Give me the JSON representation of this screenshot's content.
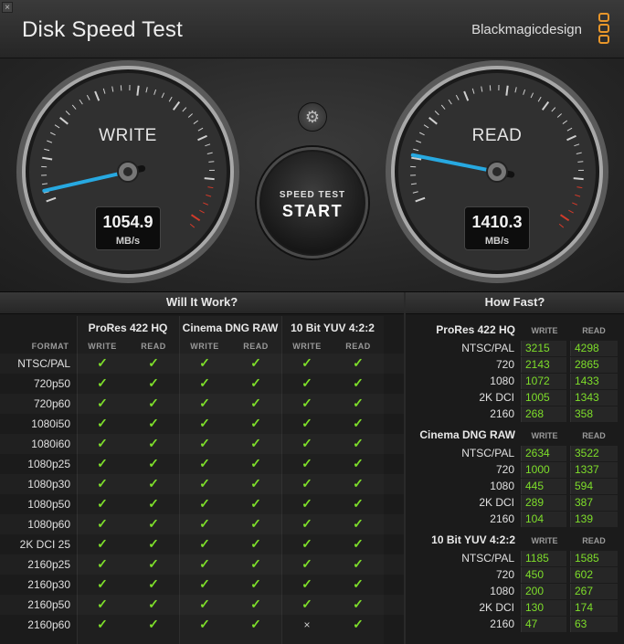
{
  "window": {
    "title": "Disk Speed Test",
    "brand": "Blackmagicdesign",
    "close_glyph": "×"
  },
  "gauges": {
    "write": {
      "label": "WRITE",
      "value": "1054.9",
      "unit": "MB/s",
      "needle_fraction": 0.03
    },
    "read": {
      "label": "READ",
      "value": "1410.3",
      "unit": "MB/s",
      "needle_fraction": 0.13
    }
  },
  "controls": {
    "settings_icon": "gear-icon",
    "start_sub": "SPEED TEST",
    "start_main": "START"
  },
  "will_it_work": {
    "title": "Will It Work?",
    "format_header": "FORMAT",
    "write_header": "WRITE",
    "read_header": "READ",
    "groups": [
      "ProRes 422 HQ",
      "Cinema DNG RAW",
      "10 Bit YUV 4:2:2"
    ],
    "rows": [
      {
        "format": "NTSC/PAL",
        "cells": [
          1,
          1,
          1,
          1,
          1,
          1
        ]
      },
      {
        "format": "720p50",
        "cells": [
          1,
          1,
          1,
          1,
          1,
          1
        ]
      },
      {
        "format": "720p60",
        "cells": [
          1,
          1,
          1,
          1,
          1,
          1
        ]
      },
      {
        "format": "1080i50",
        "cells": [
          1,
          1,
          1,
          1,
          1,
          1
        ]
      },
      {
        "format": "1080i60",
        "cells": [
          1,
          1,
          1,
          1,
          1,
          1
        ]
      },
      {
        "format": "1080p25",
        "cells": [
          1,
          1,
          1,
          1,
          1,
          1
        ]
      },
      {
        "format": "1080p30",
        "cells": [
          1,
          1,
          1,
          1,
          1,
          1
        ]
      },
      {
        "format": "1080p50",
        "cells": [
          1,
          1,
          1,
          1,
          1,
          1
        ]
      },
      {
        "format": "1080p60",
        "cells": [
          1,
          1,
          1,
          1,
          1,
          1
        ]
      },
      {
        "format": "2K DCI 25",
        "cells": [
          1,
          1,
          1,
          1,
          1,
          1
        ]
      },
      {
        "format": "2160p25",
        "cells": [
          1,
          1,
          1,
          1,
          1,
          1
        ]
      },
      {
        "format": "2160p30",
        "cells": [
          1,
          1,
          1,
          1,
          1,
          1
        ]
      },
      {
        "format": "2160p50",
        "cells": [
          1,
          1,
          1,
          1,
          1,
          1
        ]
      },
      {
        "format": "2160p60",
        "cells": [
          1,
          1,
          1,
          1,
          0,
          1
        ]
      }
    ],
    "check_glyph": "✓",
    "cross_glyph": "×"
  },
  "how_fast": {
    "title": "How Fast?",
    "write_header": "WRITE",
    "read_header": "READ",
    "groups": [
      {
        "name": "ProRes 422 HQ",
        "rows": [
          {
            "res": "NTSC/PAL",
            "write": "3215",
            "read": "4298"
          },
          {
            "res": "720",
            "write": "2143",
            "read": "2865"
          },
          {
            "res": "1080",
            "write": "1072",
            "read": "1433"
          },
          {
            "res": "2K DCI",
            "write": "1005",
            "read": "1343"
          },
          {
            "res": "2160",
            "write": "268",
            "read": "358"
          }
        ]
      },
      {
        "name": "Cinema DNG RAW",
        "rows": [
          {
            "res": "NTSC/PAL",
            "write": "2634",
            "read": "3522"
          },
          {
            "res": "720",
            "write": "1000",
            "read": "1337"
          },
          {
            "res": "1080",
            "write": "445",
            "read": "594"
          },
          {
            "res": "2K DCI",
            "write": "289",
            "read": "387"
          },
          {
            "res": "2160",
            "write": "104",
            "read": "139"
          }
        ]
      },
      {
        "name": "10 Bit YUV 4:2:2",
        "rows": [
          {
            "res": "NTSC/PAL",
            "write": "1185",
            "read": "1585"
          },
          {
            "res": "720",
            "write": "450",
            "read": "602"
          },
          {
            "res": "1080",
            "write": "200",
            "read": "267"
          },
          {
            "res": "2K DCI",
            "write": "130",
            "read": "174"
          },
          {
            "res": "2160",
            "write": "47",
            "read": "63"
          }
        ]
      }
    ]
  },
  "colors": {
    "accent": "#7ede2a",
    "needle": "#27a9e1",
    "redline": "#d23a2a",
    "brand_logo": "#e8962a"
  }
}
